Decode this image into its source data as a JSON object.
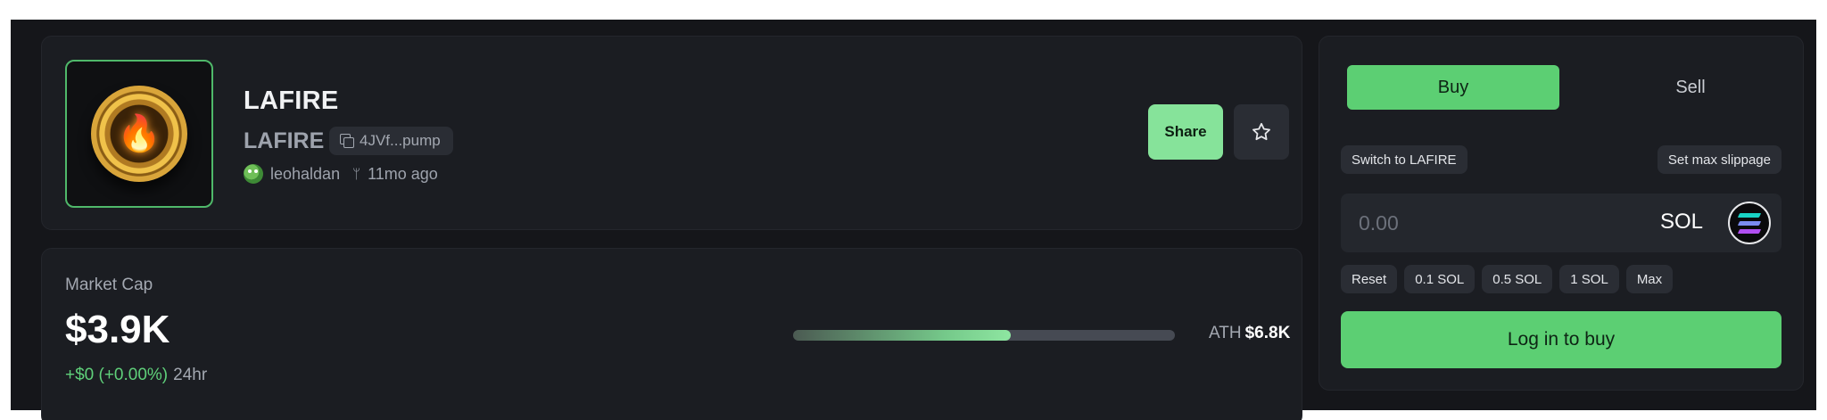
{
  "token": {
    "name": "LAFIRE",
    "symbol": "LAFIRE",
    "contract_short": "4JVf...pump",
    "creator": "leohaldan",
    "age": "11mo ago",
    "image_icon": "fire-coin-logo",
    "share_label": "Share",
    "favorite_icon": "star-icon",
    "accent_color": "#4fb86a"
  },
  "market": {
    "label": "Market Cap",
    "value": "$3.9K",
    "change": "+$0 (+0.00%)",
    "period": "24hr",
    "ath_label": "ATH",
    "ath_value": "$6.8K",
    "progress_fraction": 0.57
  },
  "trade": {
    "tabs": [
      {
        "label": "Buy",
        "active": true
      },
      {
        "label": "Sell",
        "active": false
      }
    ],
    "switch_label": "Switch to LAFIRE",
    "slippage_label": "Set max slippage",
    "amount_placeholder": "0.00",
    "currency": "SOL",
    "quick_amounts": [
      "Reset",
      "0.1 SOL",
      "0.5 SOL",
      "1 SOL",
      "Max"
    ],
    "submit_label": "Log in to buy",
    "accent_color": "#5ccf73"
  }
}
